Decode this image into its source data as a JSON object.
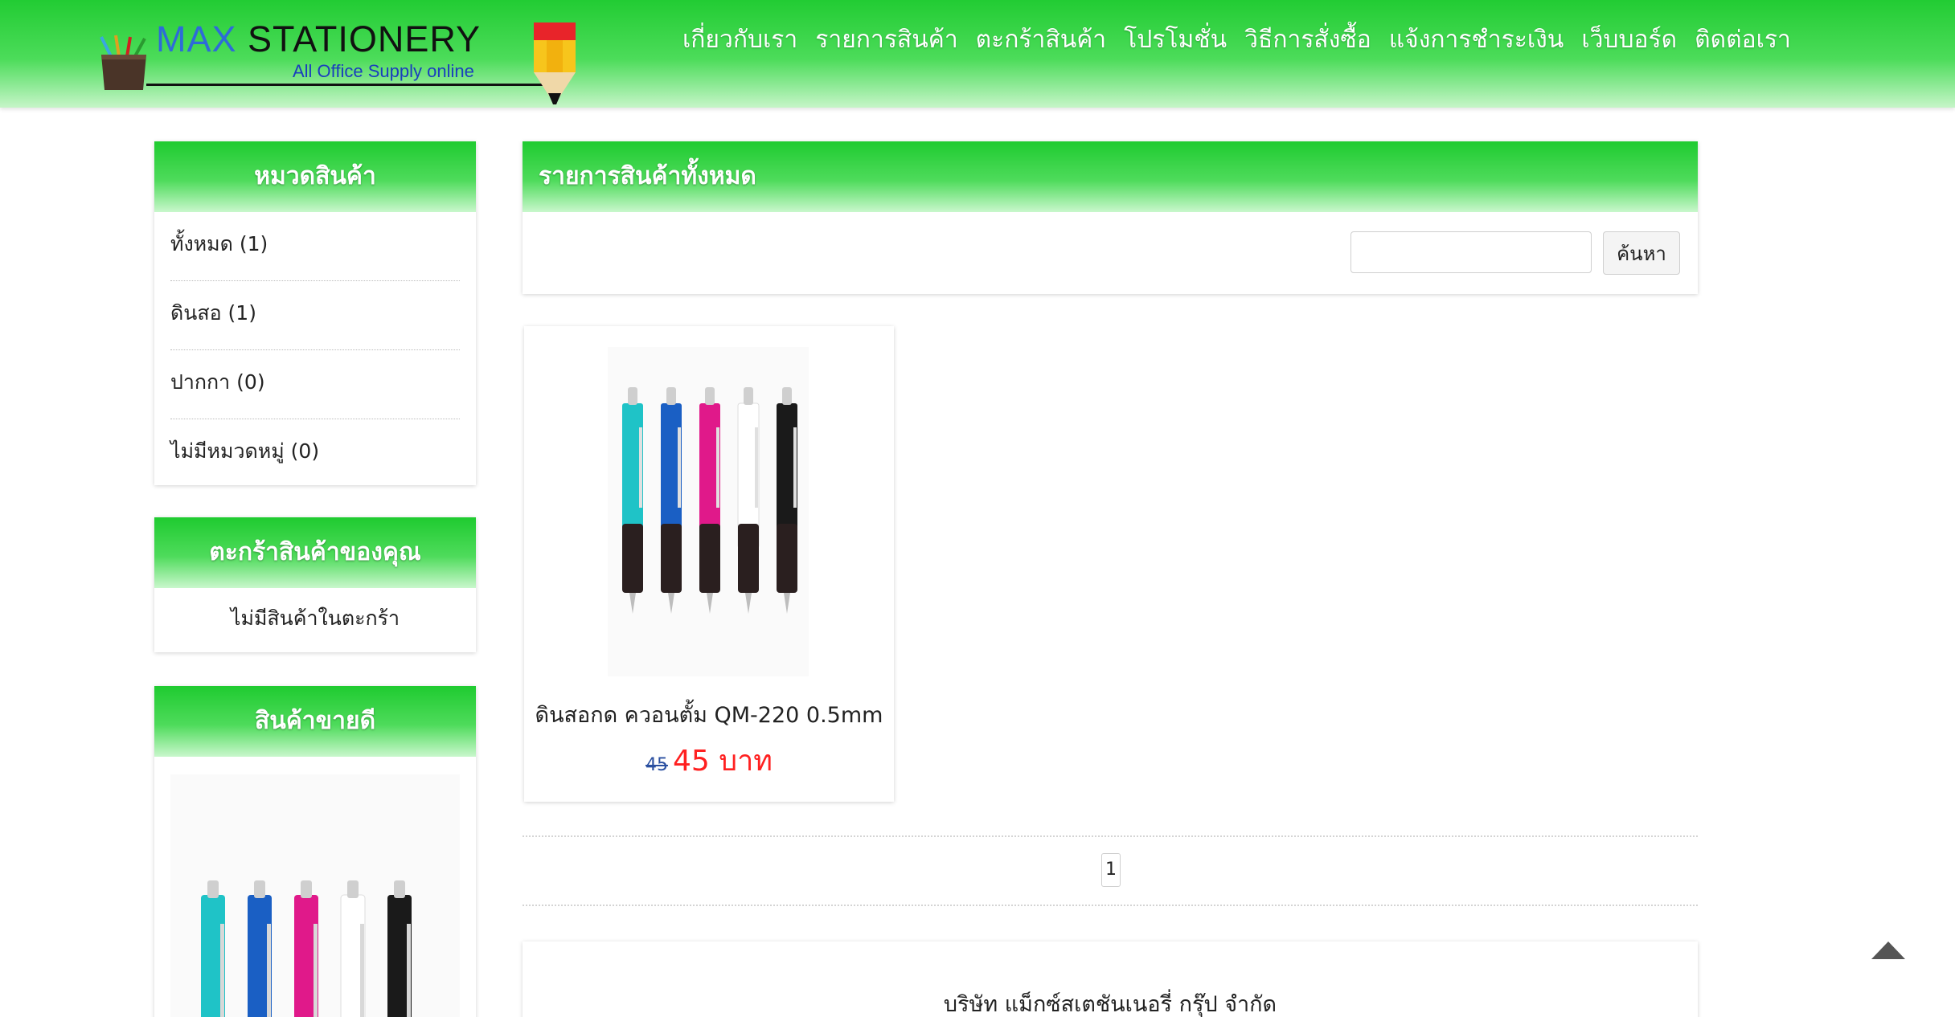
{
  "brand": {
    "name_part1": "MAX",
    "name_part2": "STATIONERY",
    "tagline": "All Office Supply online"
  },
  "nav": {
    "items": [
      {
        "label": "เกี่ยวกับเรา"
      },
      {
        "label": "รายการสินค้า"
      },
      {
        "label": "ตะกร้าสินค้า"
      },
      {
        "label": "โปรโมชั่น"
      },
      {
        "label": "วิธีการสั่งซื้อ"
      },
      {
        "label": "แจ้งการชำระเงิน"
      },
      {
        "label": "เว็บบอร์ด"
      },
      {
        "label": "ติดต่อเรา"
      }
    ]
  },
  "sidebar": {
    "categories": {
      "title": "หมวดสินค้า",
      "items": [
        {
          "label": "ทั้งหมด (1)"
        },
        {
          "label": "ดินสอ (1)"
        },
        {
          "label": "ปากกา (0)"
        },
        {
          "label": "ไม่มีหมวดหมู่ (0)"
        }
      ]
    },
    "cart": {
      "title": "ตะกร้าสินค้าของคุณ",
      "empty_text": "ไม่มีสินค้าในตะกร้า"
    },
    "bestseller": {
      "title": "สินค้าขายดี"
    }
  },
  "main": {
    "title": "รายการสินค้าทั้งหมด",
    "search": {
      "placeholder": "",
      "button_label": "ค้นหา"
    },
    "products": [
      {
        "name": "ดินสอกด ควอนตั้ม QM-220 0.5mm",
        "old_price": "45",
        "price": "45 บาท"
      }
    ],
    "pagination": {
      "current": "1"
    }
  },
  "footer": {
    "company": "บริษัท แม็กซ์สเตชันเนอรี่ กรุ๊ป จำกัด"
  },
  "colors": {
    "header_green": "#22cc33",
    "price_red": "#ff2020",
    "old_price_blue": "#2a4fa0",
    "pen_colors": [
      "#1fc3c7",
      "#1a5fc4",
      "#e0198a",
      "#ffffff",
      "#1a1a1a"
    ]
  },
  "icons": [
    "pencil-cup-icon",
    "pencil-icon",
    "scroll-top-icon"
  ]
}
